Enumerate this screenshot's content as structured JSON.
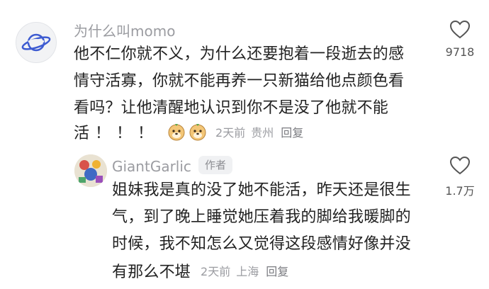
{
  "comments": [
    {
      "username": "为什么叫momo",
      "text_lines": [
        "他不仁你就不义，为什么还要抱着一段逝去的感",
        "情守活寡，你就不能再养一只新猫给他点颜色看",
        "看吗？让他清醒地认识到你不是没了他就不能"
      ],
      "last_line_text": "活！！！",
      "emoji_icon": "dog-face-emoji-icon",
      "time": "2天前",
      "location": "贵州",
      "reply_label": "回复",
      "like_count": "9718"
    },
    {
      "username": "GiantGarlic",
      "badge": "作者",
      "text_lines": [
        "姐妹我是真的没了她不能活，昨天还是很生",
        "气，到了晚上睡觉她压着我的脚给我暖脚的",
        "时候，我不知怎么又觉得这段感情好像并没",
        "有那么不堪"
      ],
      "time": "2天前",
      "location": "上海",
      "reply_label": "回复",
      "like_count": "1.7万"
    }
  ],
  "colors": {
    "text": "#222222",
    "muted": "#9b9ca1",
    "badge_bg": "#f0f1f3"
  }
}
